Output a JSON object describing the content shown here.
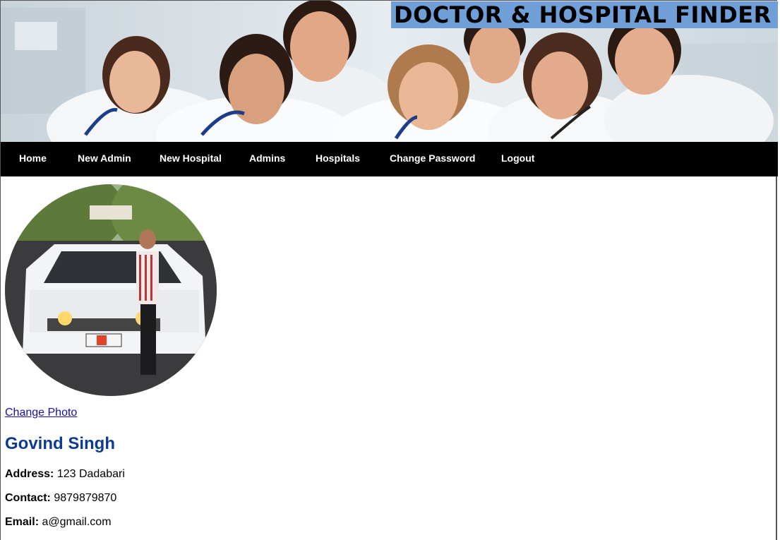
{
  "header": {
    "title": "DOCTOR & HOSPITAL FINDER",
    "banner_image": "group-of-smiling-doctors-photo"
  },
  "nav": {
    "items": [
      {
        "label": "Home"
      },
      {
        "label": "New Admin"
      },
      {
        "label": "New Hospital"
      },
      {
        "label": "Admins"
      },
      {
        "label": "Hospitals"
      },
      {
        "label": "Change Password"
      },
      {
        "label": "Logout"
      }
    ]
  },
  "profile": {
    "photo": "man-standing-beside-white-car-photo",
    "change_photo_label": "Change Photo",
    "name": "Govind Singh",
    "fields": [
      {
        "label": "Address:",
        "value": "123 Dadabari"
      },
      {
        "label": "Contact:",
        "value": "9879879870"
      },
      {
        "label": "Email:",
        "value": "a@gmail.com"
      }
    ]
  },
  "colors": {
    "title_bg": "#6f9fd6",
    "nav_bg": "#000000",
    "name_color": "#0d3b8e",
    "link_color": "#1a0dab"
  }
}
